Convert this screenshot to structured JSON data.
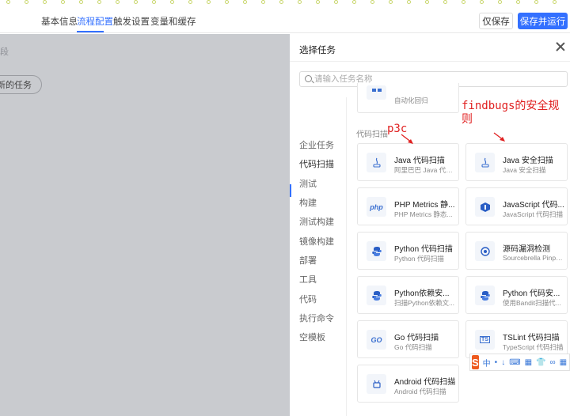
{
  "header": {
    "tabs": [
      {
        "label": "基本信息",
        "active": false
      },
      {
        "label": "流程配置",
        "active": true
      },
      {
        "label": "触发设置",
        "active": false
      },
      {
        "label": "变量和缓存",
        "active": false
      }
    ],
    "save_label": "仅保存",
    "save_run_label": "保存并运行"
  },
  "overlay": {
    "partial_text": "段",
    "new_task_label": "新的任务"
  },
  "drawer": {
    "title": "选择任务",
    "search_placeholder": "请输入任务名称",
    "categories": [
      {
        "label": "企业任务",
        "active": false
      },
      {
        "label": "代码扫描",
        "active": true
      },
      {
        "label": "测试",
        "active": false
      },
      {
        "label": "构建",
        "active": false
      },
      {
        "label": "测试构建",
        "active": false
      },
      {
        "label": "镜像构建",
        "active": false
      },
      {
        "label": "部署",
        "active": false
      },
      {
        "label": "工具",
        "active": false
      },
      {
        "label": "代码",
        "active": false
      },
      {
        "label": "执行命令",
        "active": false
      },
      {
        "label": "空模板",
        "active": false
      }
    ],
    "partial_card_desc": "自动化回归",
    "section_label": "代码扫描",
    "cards": [
      {
        "title": "Java 代码扫描",
        "desc": "阿里巴巴 Java 代码...",
        "icon": "java-icon"
      },
      {
        "title": "Java 安全扫描",
        "desc": "Java 安全扫描",
        "icon": "java-icon"
      },
      {
        "title": "PHP Metrics 静...",
        "desc": "PHP Metrics 静态...",
        "icon": "php-icon",
        "icon_text": "php"
      },
      {
        "title": "JavaScript 代码...",
        "desc": "JavaScript 代码扫描",
        "icon": "javascript-icon"
      },
      {
        "title": "Python 代码扫描",
        "desc": "Python 代码扫描",
        "icon": "python-icon"
      },
      {
        "title": "源码漏洞检测",
        "desc": "Sourcebrella Pinpoi...",
        "icon": "vulnerability-scan-icon"
      },
      {
        "title": "Python依赖安...",
        "desc": "扫描Python依赖文...",
        "icon": "python-icon"
      },
      {
        "title": "Python 代码安...",
        "desc": "使用Bandit扫描代...",
        "icon": "python-icon"
      },
      {
        "title": "Go 代码扫描",
        "desc": "Go 代码扫描",
        "icon": "go-icon",
        "icon_text": "GO"
      },
      {
        "title": "TSLint 代码扫描",
        "desc": "TypeScript 代码扫描",
        "icon": "typescript-icon",
        "icon_text": "TS"
      },
      {
        "title": "Android 代码扫描",
        "desc": "Android 代码扫描",
        "icon": "android-icon"
      }
    ]
  },
  "annotations": {
    "left": "p3c",
    "right_line1": "findbugs的安全规",
    "right_line2": "则",
    "color": "#e02020"
  },
  "ime": {
    "logo": "S",
    "items": [
      "中",
      "•",
      "↓",
      "⌨",
      "▦",
      "👕",
      "∞",
      "▦",
      "≡"
    ]
  },
  "colors": {
    "accent": "#3370ff",
    "overlay": "#c9cbcf"
  }
}
